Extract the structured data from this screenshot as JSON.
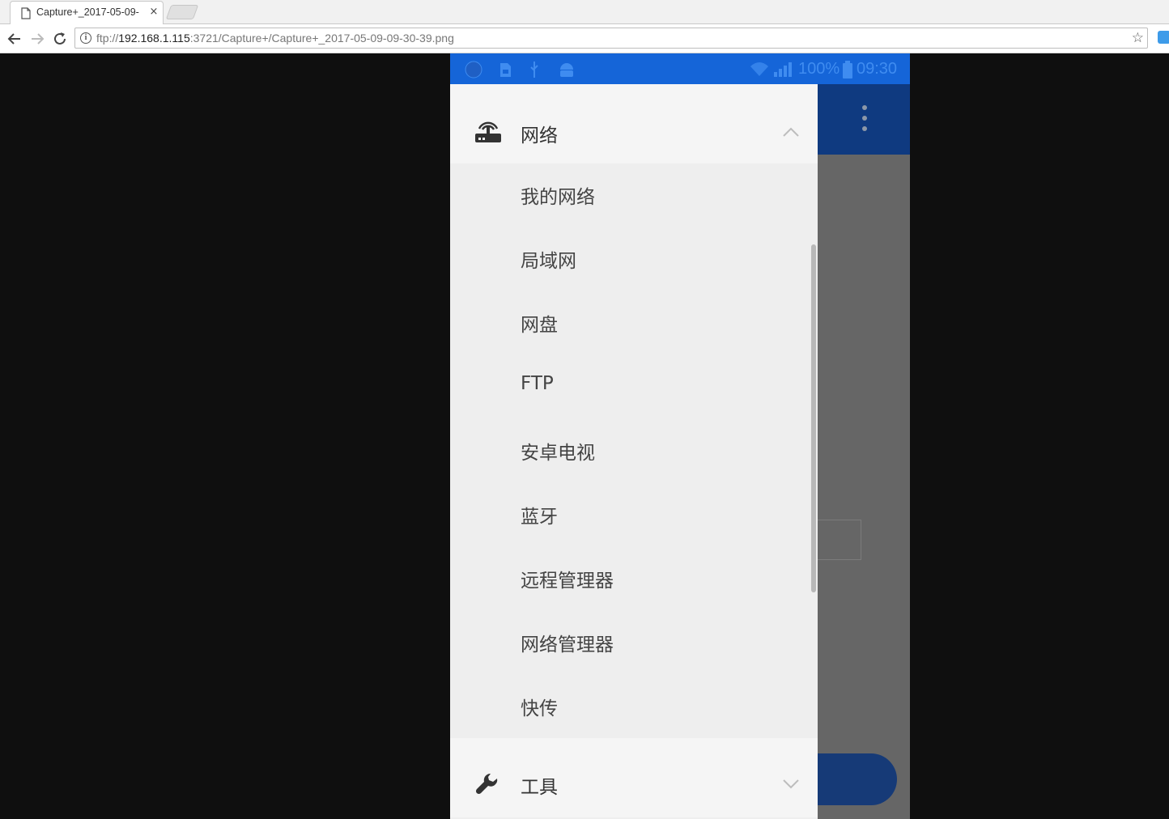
{
  "browser": {
    "tab_title": "Capture+_2017-05-09-",
    "tab_close": "×",
    "url_scheme": "ftp://",
    "url_host": "192.168.1.115",
    "url_rest": ":3721/Capture+/Capture+_2017-05-09-09-30-39.png"
  },
  "statusbar": {
    "battery": "100%",
    "time": "09:30"
  },
  "drawer": {
    "network_group": {
      "label": "网络",
      "icon": "router-icon",
      "expanded": true,
      "items": [
        {
          "label": "我的网络"
        },
        {
          "label": "局域网"
        },
        {
          "label": "网盘"
        },
        {
          "label": "FTP"
        },
        {
          "label": "安卓电视"
        },
        {
          "label": "蓝牙"
        },
        {
          "label": "远程管理器"
        },
        {
          "label": "网络管理器"
        },
        {
          "label": "快传"
        }
      ]
    },
    "tools_group": {
      "label": "工具",
      "icon": "wrench-icon",
      "expanded": false
    }
  },
  "colors": {
    "statusbar": "#1565d8",
    "appbar": "#0f3a80",
    "drawer_bg": "#eeeeee",
    "header_bg": "#f5f5f5",
    "page_bg": "#0f0f0f"
  }
}
